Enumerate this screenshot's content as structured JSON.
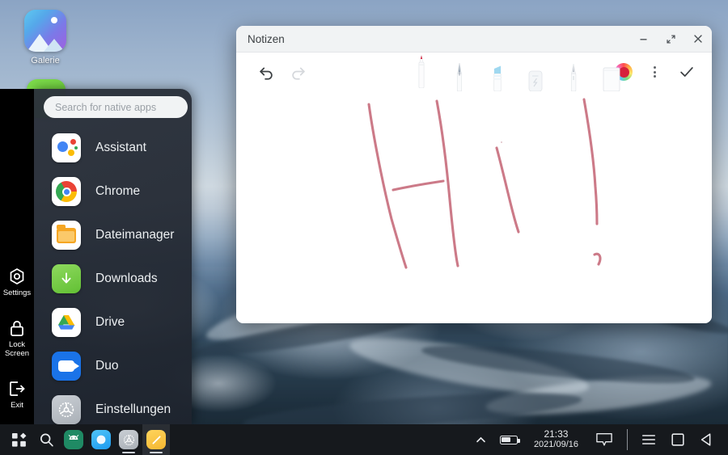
{
  "desktop": {
    "icon_label": "Galerie",
    "wallpaper_description": "snow-covered mountain glacier"
  },
  "launcher": {
    "search": {
      "placeholder": "Search for native apps",
      "value": ""
    },
    "apps": [
      {
        "label": "Assistant",
        "icon": "google-assistant-icon"
      },
      {
        "label": "Chrome",
        "icon": "chrome-icon"
      },
      {
        "label": "Dateimanager",
        "icon": "folder-icon"
      },
      {
        "label": "Downloads",
        "icon": "download-arrow-icon"
      },
      {
        "label": "Drive",
        "icon": "google-drive-icon"
      },
      {
        "label": "Duo",
        "icon": "video-camera-icon"
      },
      {
        "label": "Einstellungen",
        "icon": "gear-icon"
      }
    ]
  },
  "rail": {
    "items": [
      {
        "label": "Settings",
        "icon": "settings-hex-icon"
      },
      {
        "label": "Lock\nScreen",
        "label_line1": "Lock",
        "label_line2": "Screen",
        "icon": "padlock-icon"
      },
      {
        "label": "Exit",
        "icon": "exit-arrow-icon"
      }
    ]
  },
  "window": {
    "title": "Notizen",
    "controls": {
      "minimize": "minimize-icon",
      "maximize": "maximize-icon",
      "close": "close-icon"
    },
    "toolbar": {
      "undo": {
        "name": "undo-icon",
        "enabled": true
      },
      "redo": {
        "name": "redo-icon",
        "enabled": false
      },
      "tools": [
        {
          "name": "marker-pen",
          "selected": true,
          "tip_color": "#d6213b"
        },
        {
          "name": "fountain-pen",
          "selected": false,
          "tip_color": "#8a98a8"
        },
        {
          "name": "highlighter",
          "selected": false,
          "tip_color": "#9fd8f0"
        },
        {
          "name": "eraser",
          "selected": false,
          "tip_color": "#e8eaec"
        },
        {
          "name": "pencil",
          "selected": false,
          "tip_color": "#b8bec6"
        },
        {
          "name": "paper-sheet",
          "selected": false,
          "tip_color": "#eceef0"
        }
      ],
      "color_swatch": {
        "name": "color-picker",
        "selected_color": "#d6213b"
      },
      "more": "more-options-icon",
      "done": "checkmark-icon"
    },
    "canvas": {
      "stroke_color": "#cc7a88",
      "content_description": "handwritten Hi!"
    }
  },
  "taskbar": {
    "apps": [
      {
        "name": "all-apps-grid-icon",
        "active": false,
        "running": false
      },
      {
        "name": "search-icon",
        "active": false,
        "running": false
      },
      {
        "name": "android-app-icon",
        "active": false,
        "running": false
      },
      {
        "name": "blue-app-icon",
        "active": false,
        "running": false
      },
      {
        "name": "settings-app-icon",
        "active": false,
        "running": true
      },
      {
        "name": "notes-app-icon",
        "active": true,
        "running": true
      }
    ],
    "tray": {
      "expand": "chevron-up-icon",
      "battery": "battery-icon",
      "time": "21:33",
      "date": "2021/09/16",
      "messages": "chat-bubble-icon"
    },
    "nav": {
      "recents": "recents-icon",
      "home": "home-square-icon",
      "back": "back-triangle-icon"
    }
  }
}
